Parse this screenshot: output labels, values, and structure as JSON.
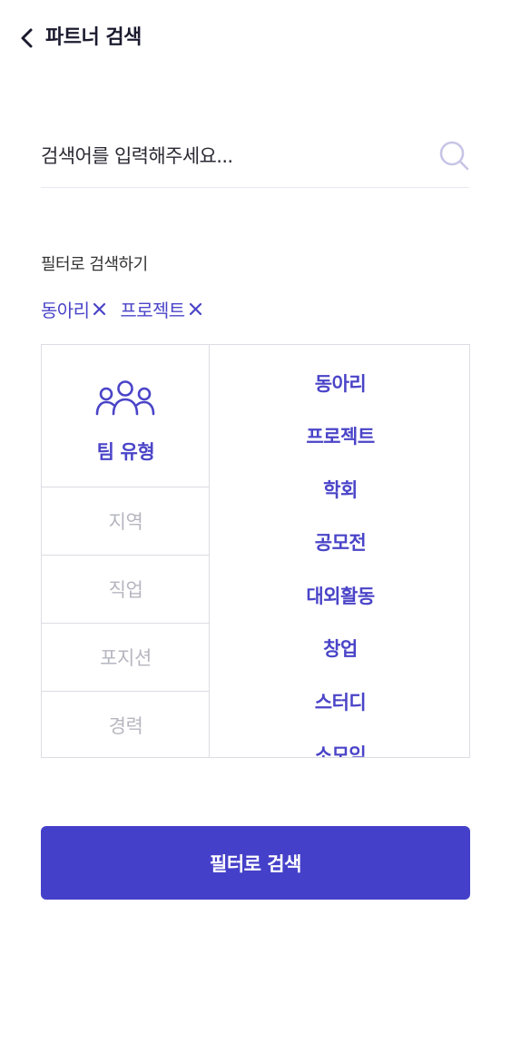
{
  "header": {
    "title": "파트너 검색",
    "back_icon": "chevron-left-icon"
  },
  "search": {
    "placeholder": "검색어를 입력해주세요...",
    "value": "",
    "icon": "search-icon"
  },
  "filter": {
    "label": "필터로 검색하기",
    "selected_chips": [
      {
        "label": "동아리",
        "remove_icon": "close-icon"
      },
      {
        "label": "프로젝트",
        "remove_icon": "close-icon"
      }
    ],
    "categories": [
      {
        "label": "팀 유형",
        "icon": "people-group-icon",
        "active": true
      },
      {
        "label": "지역",
        "active": false
      },
      {
        "label": "직업",
        "active": false
      },
      {
        "label": "포지션",
        "active": false
      },
      {
        "label": "경력",
        "active": false
      }
    ],
    "options": [
      "동아리",
      "프로젝트",
      "학회",
      "공모전",
      "대외활동",
      "창업",
      "스터디",
      "소모임"
    ]
  },
  "submit": {
    "label": "필터로 검색"
  },
  "colors": {
    "accent": "#4540c9",
    "inactive_text": "#b6b6c0",
    "border": "#dcdce3"
  }
}
